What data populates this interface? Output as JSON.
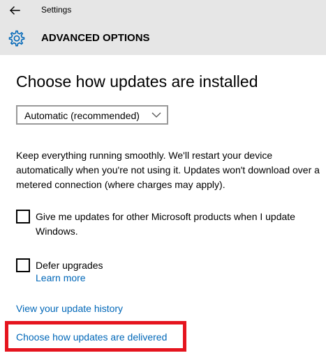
{
  "titlebar": {
    "title": "Settings"
  },
  "header": {
    "title": "ADVANCED OPTIONS"
  },
  "section": {
    "title": "Choose how updates are installed"
  },
  "dropdown": {
    "selected": "Automatic (recommended)"
  },
  "description": "Keep everything running smoothly. We'll restart your device automatically when you're not using it. Updates won't download over a metered connection (where charges may apply).",
  "checkboxes": [
    {
      "label": "Give me updates for other Microsoft products when I update Windows.",
      "checked": false
    },
    {
      "label": "Defer upgrades",
      "checked": false
    }
  ],
  "links": {
    "learn_more": "Learn more",
    "update_history": "View your update history",
    "delivery": "Choose how updates are delivered"
  },
  "colors": {
    "header_bg": "#e6e6e6",
    "accent": "#0067b8",
    "link": "#0067b8",
    "highlight": "#e5141e"
  },
  "icons": {
    "back": "back-arrow-icon",
    "settings": "gear-icon",
    "dropdown": "chevron-down-icon"
  }
}
